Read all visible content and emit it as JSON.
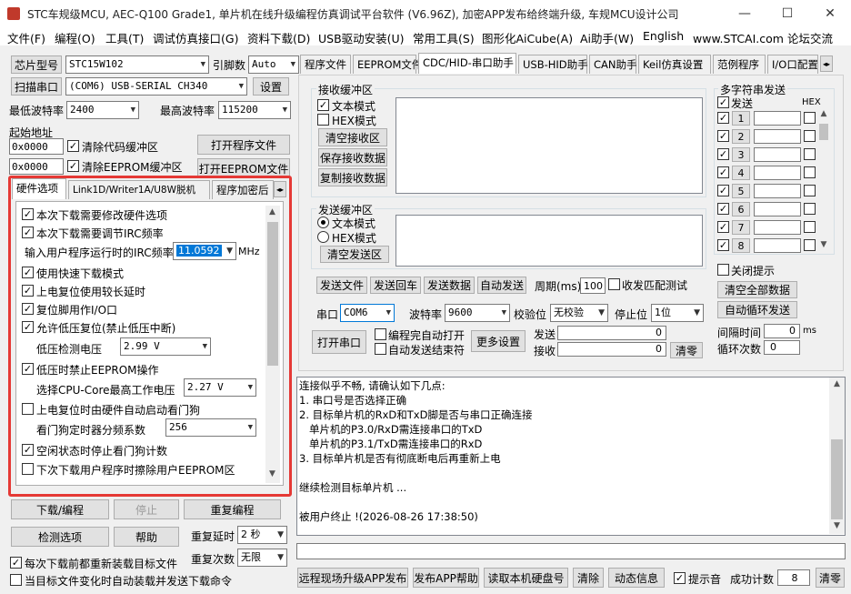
{
  "window": {
    "title": "STC车规级MCU, AEC-Q100 Grade1, 单片机在线升级编程仿真调试平台软件 (V6.96Z), 加密APP发布给终端升级, 车规MCU设计公司",
    "minimize": "—",
    "maximize": "☐",
    "close": "✕"
  },
  "menu": [
    "文件(F)",
    "编程(O)",
    "工具(T)",
    "调试仿真接口(G)",
    "资料下载(D)",
    "USB驱动安装(U)",
    "常用工具(S)",
    "图形化AiCube(A)",
    "Ai助手(W)",
    "English",
    "www.STCAI.com 论坛交流"
  ],
  "left": {
    "chip_type_btn": "芯片型号",
    "chip_value": "STC15W102",
    "pin_label": "引脚数",
    "pin_value": "Auto",
    "scan_btn": "扫描串口",
    "port_value": "(COM6) USB-SERIAL CH340",
    "settings_btn": "设置",
    "min_baud_label": "最低波特率",
    "min_baud_value": "2400",
    "max_baud_label": "最高波特率",
    "max_baud_value": "115200",
    "start_addr_label": "起始地址",
    "addr1": "0x0000",
    "clear_code_label": "清除代码缓冲区",
    "open_prog_btn": "打开程序文件",
    "addr2": "0x0000",
    "clear_eeprom_label": "清除EEPROM缓冲区",
    "open_eeprom_btn": "打开EEPROM文件",
    "tabs": [
      "硬件选项",
      "Link1D/Writer1A/U8W脱机",
      "程序加密后"
    ],
    "options": {
      "opt1": "本次下载需要修改硬件选项",
      "opt2": "本次下载需要调节IRC频率",
      "irc_label": "输入用户程序运行时的IRC频率",
      "irc_value": "11.0592",
      "irc_unit": "MHz",
      "opt3": "使用快速下载模式",
      "opt4": "上电复位使用较长延时",
      "opt5": "复位脚用作I/O口",
      "opt6": "允许低压复位(禁止低压中断)",
      "lv_label": "低压检测电压",
      "lv_value": "2.99 V",
      "opt7": "低压时禁止EEPROM操作",
      "cpu_label": "选择CPU-Core最高工作电压",
      "cpu_value": "2.27 V",
      "opt8": "上电复位时由硬件自动启动看门狗",
      "wdt_label": "看门狗定时器分频系数",
      "wdt_value": "256",
      "opt9": "空闲状态时停止看门狗计数",
      "opt10": "下次下载用户程序时擦除用户EEPROM区"
    },
    "download_btn": "下载/编程",
    "stop_btn": "停止",
    "reprogram_btn": "重复编程",
    "check_btn": "检测选项",
    "help_btn": "帮助",
    "repeat_delay_label": "重复延时",
    "repeat_delay_value": "2 秒",
    "repeat_count_label": "重复次数",
    "repeat_count_value": "无限",
    "reload_label": "每次下载前都重新装载目标文件",
    "auto_send_label": "当目标文件变化时自动装载并发送下载命令"
  },
  "right": {
    "tabs": [
      "程序文件",
      "EEPROM文件",
      "CDC/HID-串口助手",
      "USB-HID助手",
      "CAN助手",
      "Keil仿真设置",
      "范例程序",
      "I/O口配置"
    ],
    "recv_group": "接收缓冲区",
    "text_mode": "文本模式",
    "hex_mode": "HEX模式",
    "clear_recv_btn": "清空接收区",
    "save_recv_btn": "保存接收数据",
    "copy_recv_btn": "复制接收数据",
    "send_group": "发送缓冲区",
    "clear_send_btn": "清空发送区",
    "send_file_btn": "发送文件",
    "send_return_btn": "发送回车",
    "send_data_btn": "发送数据",
    "auto_send_btn": "自动发送",
    "period_label": "周期(ms)",
    "period_value": "100",
    "match_label": "收发匹配测试",
    "port_label": "串口",
    "port_value": "COM6",
    "baud_label": "波特率",
    "baud_value": "9600",
    "parity_label": "校验位",
    "parity_value": "无校验",
    "stop_label": "停止位",
    "stop_value": "1位",
    "open_port_btn": "打开串口",
    "open_after_prog": "编程完自动打开",
    "auto_send_end": "自动发送结束符",
    "more_btn": "更多设置",
    "send_label": "发送",
    "send_count": "0",
    "recv_label": "接收",
    "recv_count": "0",
    "clear_btn": "清零",
    "multi_group": "多字符串发送",
    "multi_send": "发送",
    "multi_hex": "HEX",
    "multi_rows": [
      "1",
      "2",
      "3",
      "4",
      "5",
      "6",
      "7",
      "8"
    ],
    "close_prompt": "关闭提示",
    "clear_all_btn": "清空全部数据",
    "auto_loop_btn": "自动循环发送",
    "interval_label": "间隔时间",
    "interval_value": "0",
    "interval_unit": "ms",
    "loop_label": "循环次数",
    "loop_value": "0"
  },
  "log": {
    "lines": [
      "连接似乎不畅, 请确认如下几点:",
      "1. 串口号是否选择正确",
      "2. 目标单片机的RxD和TxD脚是否与串口正确连接",
      "   单片机的P3.0/RxD需连接串口的TxD",
      "   单片机的P3.1/TxD需连接串口的RxD",
      "3. 目标单片机是否有彻底断电后再重新上电",
      "",
      "继续检测目标单片机 ...",
      "",
      "被用户终止 !(2026-08-26 17:38:50)"
    ]
  },
  "bottom": {
    "remote_btn": "远程现场升级APP发布",
    "publish_help_btn": "发布APP帮助",
    "read_disk_btn": "读取本机硬盘号",
    "clear_btn": "清除",
    "dynamic_btn": "动态信息",
    "beep_label": "提示音",
    "success_label": "成功计数",
    "success_value": "8",
    "clear_count_btn": "清零"
  },
  "colors": {
    "highlight_border": "#e53935",
    "selection": "#0078d7"
  }
}
